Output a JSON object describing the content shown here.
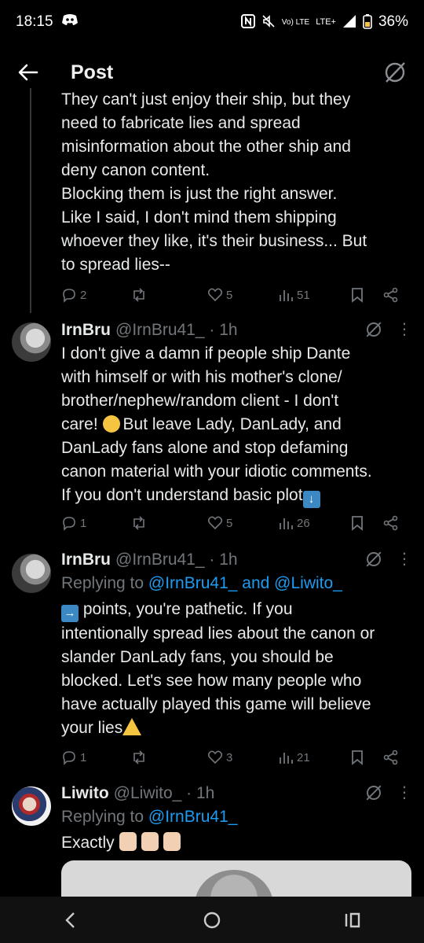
{
  "status_bar": {
    "time": "18:15",
    "network": "LTE+",
    "volte": "Vo) LTE",
    "battery": "36%"
  },
  "app_bar": {
    "title": "Post"
  },
  "top_reply": {
    "text": "They can't just enjoy their ship, but they\nneed to fabricate lies and spread\nmisinformation about the other ship and\ndeny canon content.\nBlocking them is just the right answer.\nLike I said, I don't mind them shipping\nwhoever they like, it's their business... But\nto spread lies--",
    "replies": "2",
    "likes": "5",
    "views": "51"
  },
  "tweets": [
    {
      "name": "IrnBru",
      "handle": "@IrnBru41_ · 1h",
      "text_a": "I don't give a damn if people ship Dante\nwith himself or with his mother's clone/\nbrother/nephew/random client - I don't\ncare! ",
      "text_b": "But leave Lady, DanLady, and\nDanLady fans alone and stop defaming\ncanon material with your idiotic comments.\nIf you don't understand basic plot",
      "replies": "1",
      "likes": "5",
      "views": "26"
    },
    {
      "name": "IrnBru",
      "handle": "@IrnBru41_ · 1h",
      "replying_prefix": "Replying to ",
      "replying_to_1": "@IrnBru41_",
      "replying_and": " and ",
      "replying_to_2": "@Liwito_",
      "text": " points, you're pathetic. If you\nintentionally spread lies about the canon or\nslander DanLady fans, you should be\nblocked. Let's see how many people who\nhave actually played this game will believe\nyour lies",
      "replies": "1",
      "likes": "3",
      "views": "21"
    },
    {
      "name": "Liwito",
      "handle": "@Liwito_ · 1h",
      "replying_prefix": "Replying to ",
      "replying_to_1": "@IrnBru41_",
      "text": "Exactly "
    }
  ]
}
